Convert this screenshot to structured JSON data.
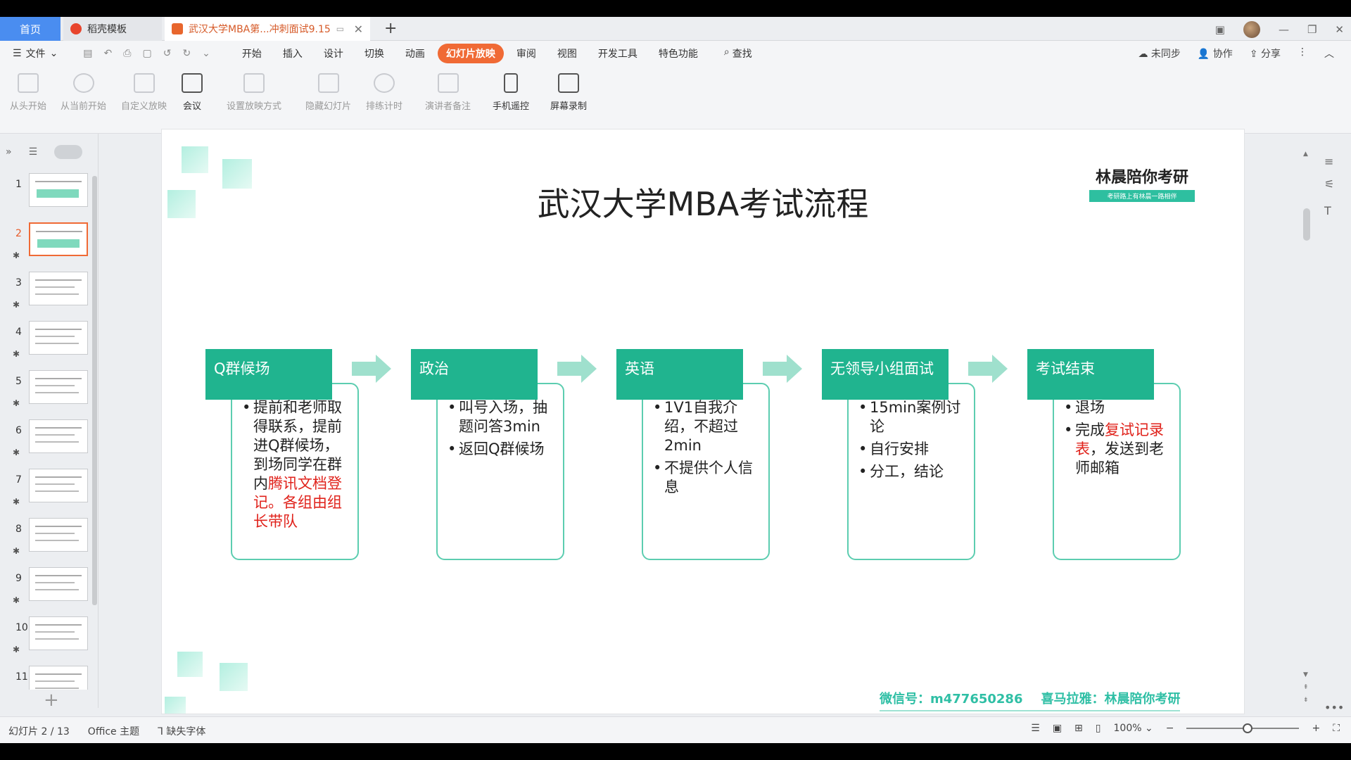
{
  "tabs": {
    "home": "首页",
    "template": "稻壳模板",
    "document": "武汉大学MBA第...冲刺面试9.15"
  },
  "menubar": {
    "file": "文件",
    "items": [
      "开始",
      "插入",
      "设计",
      "切换",
      "动画",
      "幻灯片放映",
      "审阅",
      "视图",
      "开发工具",
      "特色功能"
    ],
    "active_index": 5,
    "search": "查找",
    "sync": "未同步",
    "collab": "协作",
    "share": "分享"
  },
  "ribbon": {
    "from_start": "从头开始",
    "from_current": "从当前开始",
    "custom_show": "自定义放映",
    "meeting": "会议",
    "setup_show": "设置放映方式",
    "hide_slide": "隐藏幻灯片",
    "rehearse": "排练计时",
    "presenter_notes": "演讲者备注",
    "phone_remote": "手机遥控",
    "screen_record": "屏幕录制"
  },
  "thumbnails": [
    "1",
    "2",
    "3",
    "4",
    "5",
    "6",
    "7",
    "8",
    "9",
    "10",
    "11"
  ],
  "selected_thumbnail": 2,
  "slide": {
    "title": "武汉大学MBA考试流程",
    "brand_name": "林晨陪你考研",
    "brand_sub": "考研路上有林晨一路相伴",
    "steps": [
      {
        "title": "Q群候场",
        "bullets": [
          {
            "parts": [
              "提前和老师取得联系，提前进Q群候场，到场同学在群内",
              "腾讯文档登记。各组由组长带队"
            ]
          }
        ]
      },
      {
        "title": "政治",
        "bullets": [
          {
            "parts": [
              "叫号入场，抽题问答3min"
            ]
          },
          {
            "parts": [
              "返回Q群候场"
            ]
          }
        ]
      },
      {
        "title": "英语",
        "bullets": [
          {
            "parts": [
              "1V1自我介绍，不超过2min"
            ]
          },
          {
            "parts": [
              "不提供个人信息"
            ]
          }
        ]
      },
      {
        "title": "无领导小组面试",
        "bullets": [
          {
            "parts": [
              "15min案例讨论"
            ]
          },
          {
            "parts": [
              "自行安排"
            ]
          },
          {
            "parts": [
              "分工，结论"
            ]
          }
        ]
      },
      {
        "title": "考试结束",
        "bullets": [
          {
            "parts": [
              "退场"
            ]
          },
          {
            "parts": [
              "完成",
              "复试记录表",
              "，发送到老师邮箱"
            ]
          }
        ]
      }
    ],
    "footer_wechat": "微信号：m477650286",
    "footer_ximalaya": "喜马拉雅：林晨陪你考研"
  },
  "status": {
    "slide_counter": "幻灯片 2 / 13",
    "theme": "Office 主题",
    "missing_font": "缺失字体",
    "zoom": "100%"
  },
  "colors": {
    "accent_orange": "#f06a35",
    "teal": "#20b48f",
    "teal_light": "#5ccdb0",
    "highlight_red": "#e0221b",
    "tab_blue": "#4a8df0"
  }
}
